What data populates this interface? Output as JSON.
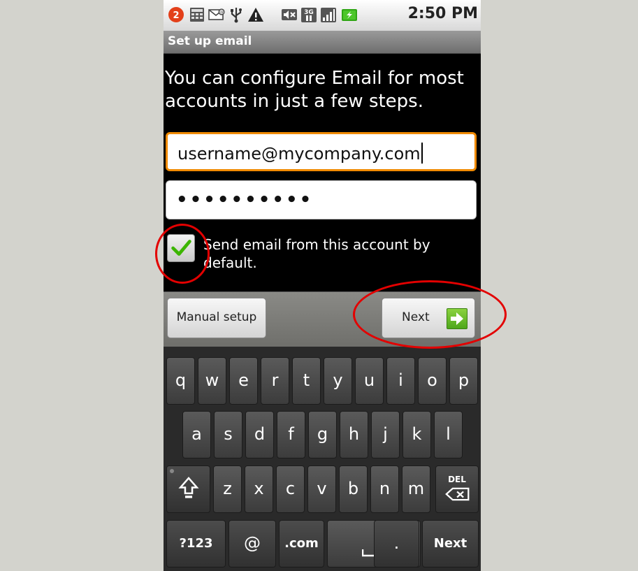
{
  "status_bar": {
    "notification_count": "2",
    "time": "2:50 PM",
    "icons": [
      "notification-badge-icon",
      "calculator-icon",
      "email-icon",
      "usb-icon",
      "warning-icon",
      "mute-icon",
      "3g-data-icon",
      "signal-icon",
      "battery-charging-icon"
    ]
  },
  "title_bar": {
    "title": "Set up email"
  },
  "intro_text": "You can configure Email for most accounts in just a few steps.",
  "email_field": {
    "value": "username@mycompany.com"
  },
  "password_field": {
    "value": "••••••••••"
  },
  "default_account": {
    "checked": true,
    "label": "Send email from this account by default."
  },
  "buttons": {
    "manual_setup": "Manual setup",
    "next": "Next"
  },
  "keyboard": {
    "row1": [
      "q",
      "w",
      "e",
      "r",
      "t",
      "y",
      "u",
      "i",
      "o",
      "p"
    ],
    "row2": [
      "a",
      "s",
      "d",
      "f",
      "g",
      "h",
      "j",
      "k",
      "l"
    ],
    "row3": [
      "z",
      "x",
      "c",
      "v",
      "b",
      "n",
      "m"
    ],
    "del_label": "DEL",
    "row4": {
      "sym": "?123",
      "at": "@",
      "dotcom": ".com",
      "period": ".",
      "next": "Next"
    }
  },
  "colors": {
    "focus_border": "#f08a00",
    "annotation": "#e30000",
    "checkmark": "#3cb500",
    "next_arrow": "#5cb82a"
  }
}
